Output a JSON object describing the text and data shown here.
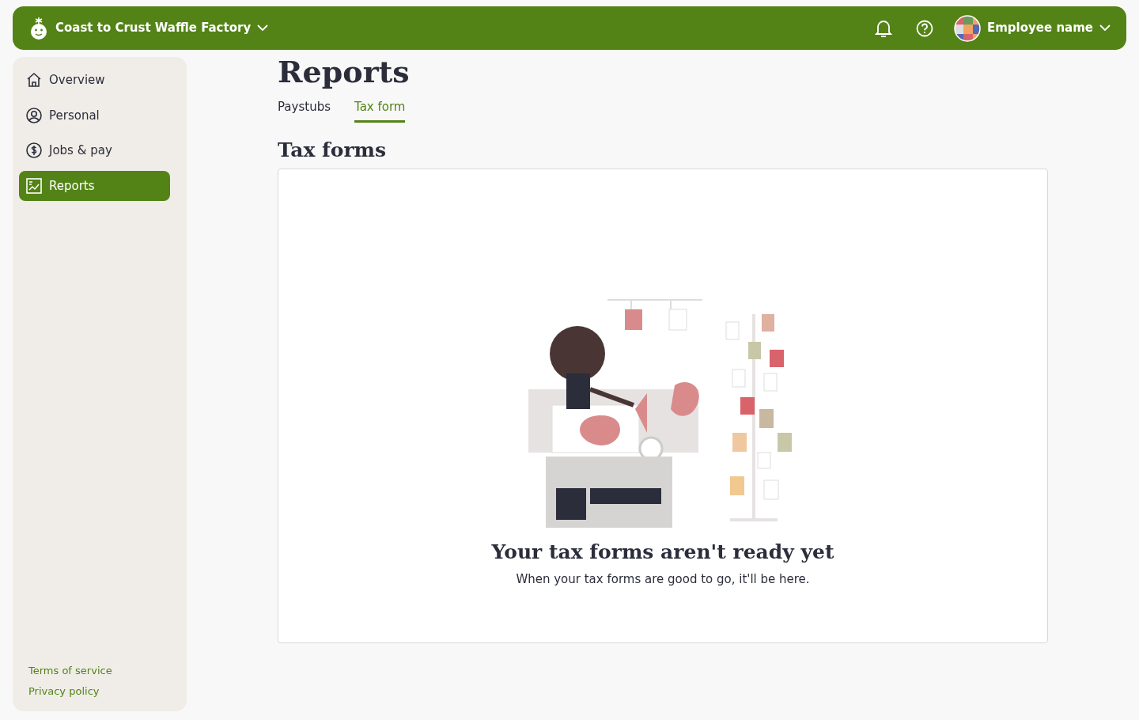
{
  "header": {
    "company": "Coast to Crust Waffle Factory",
    "user": "Employee name"
  },
  "sidebar": {
    "items": [
      {
        "label": "Overview",
        "kind": "home",
        "selected": false
      },
      {
        "label": "Personal",
        "kind": "person",
        "selected": false
      },
      {
        "label": "Jobs & pay",
        "kind": "money",
        "selected": false
      },
      {
        "label": "Reports",
        "kind": "report",
        "selected": true
      }
    ],
    "footer_links": [
      "Terms of service",
      "Privacy policy"
    ]
  },
  "page": {
    "title": "Reports",
    "tabs": [
      {
        "label": "Paystubs",
        "selected": false
      },
      {
        "label": "Tax form",
        "selected": true
      }
    ],
    "section_title": "Tax forms",
    "empty_state": {
      "title": "Your tax forms aren't ready yet",
      "message": "When your tax forms are good to go, it'll be here."
    }
  }
}
